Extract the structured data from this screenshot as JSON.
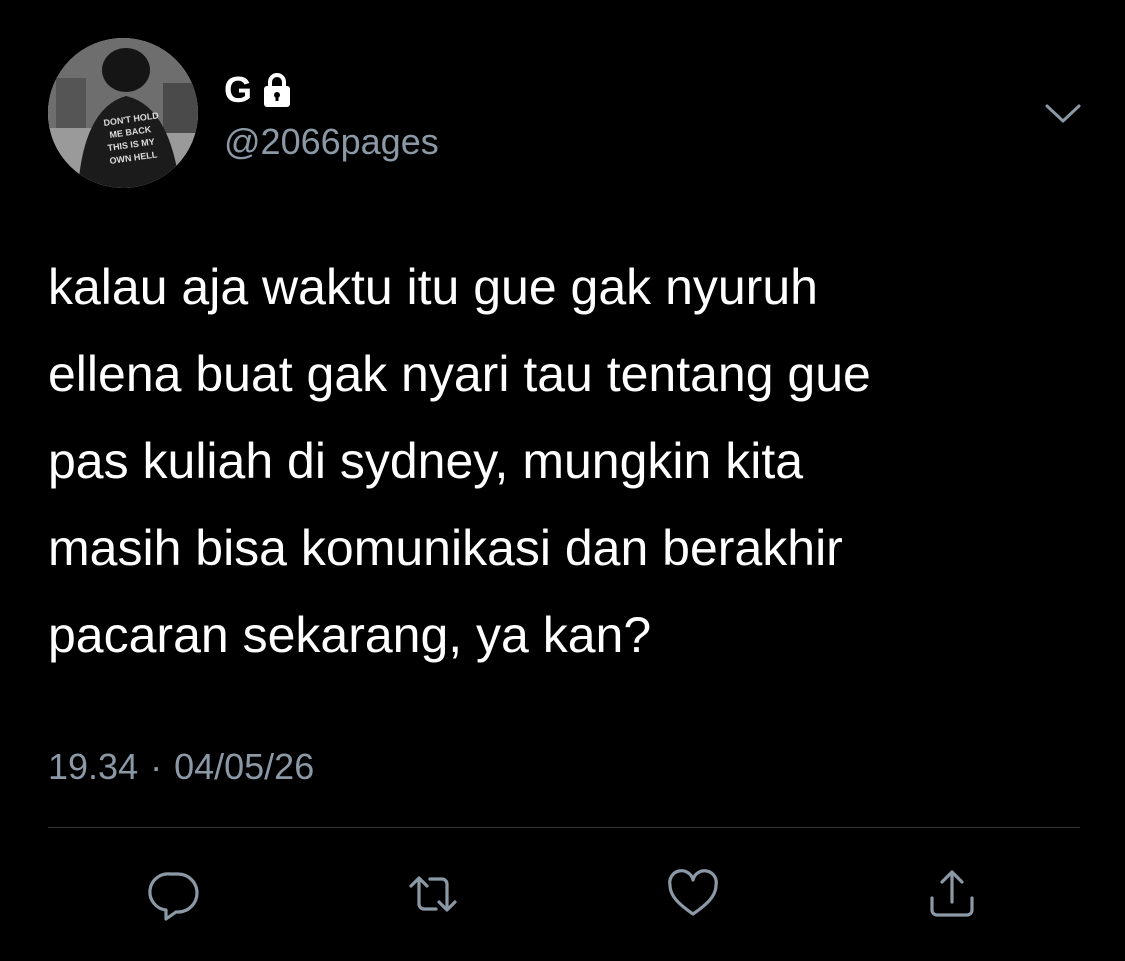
{
  "user": {
    "display_name": "G",
    "handle": "@2066pages",
    "protected": true,
    "avatar_shirt_text": [
      "DON'T HOLD",
      "ME BACK",
      "THIS IS MY",
      "OWN HELL"
    ]
  },
  "tweet": {
    "text": "kalau aja waktu itu gue gak nyuruh\nellena buat gak nyari tau tentang gue\npas kuliah di sydney, mungkin kita\nmasih bisa komunikasi dan berakhir\npacaran sekarang, ya kan?",
    "time": "19.34",
    "separator": "·",
    "date": "04/05/26"
  },
  "actions": [
    {
      "name": "reply",
      "icon": "reply-icon"
    },
    {
      "name": "retweet",
      "icon": "retweet-icon"
    },
    {
      "name": "like",
      "icon": "heart-icon"
    },
    {
      "name": "share",
      "icon": "share-icon"
    }
  ],
  "colors": {
    "background": "#000000",
    "text": "#ffffff",
    "secondary": "#8b98a5",
    "divider": "#2f3336"
  }
}
